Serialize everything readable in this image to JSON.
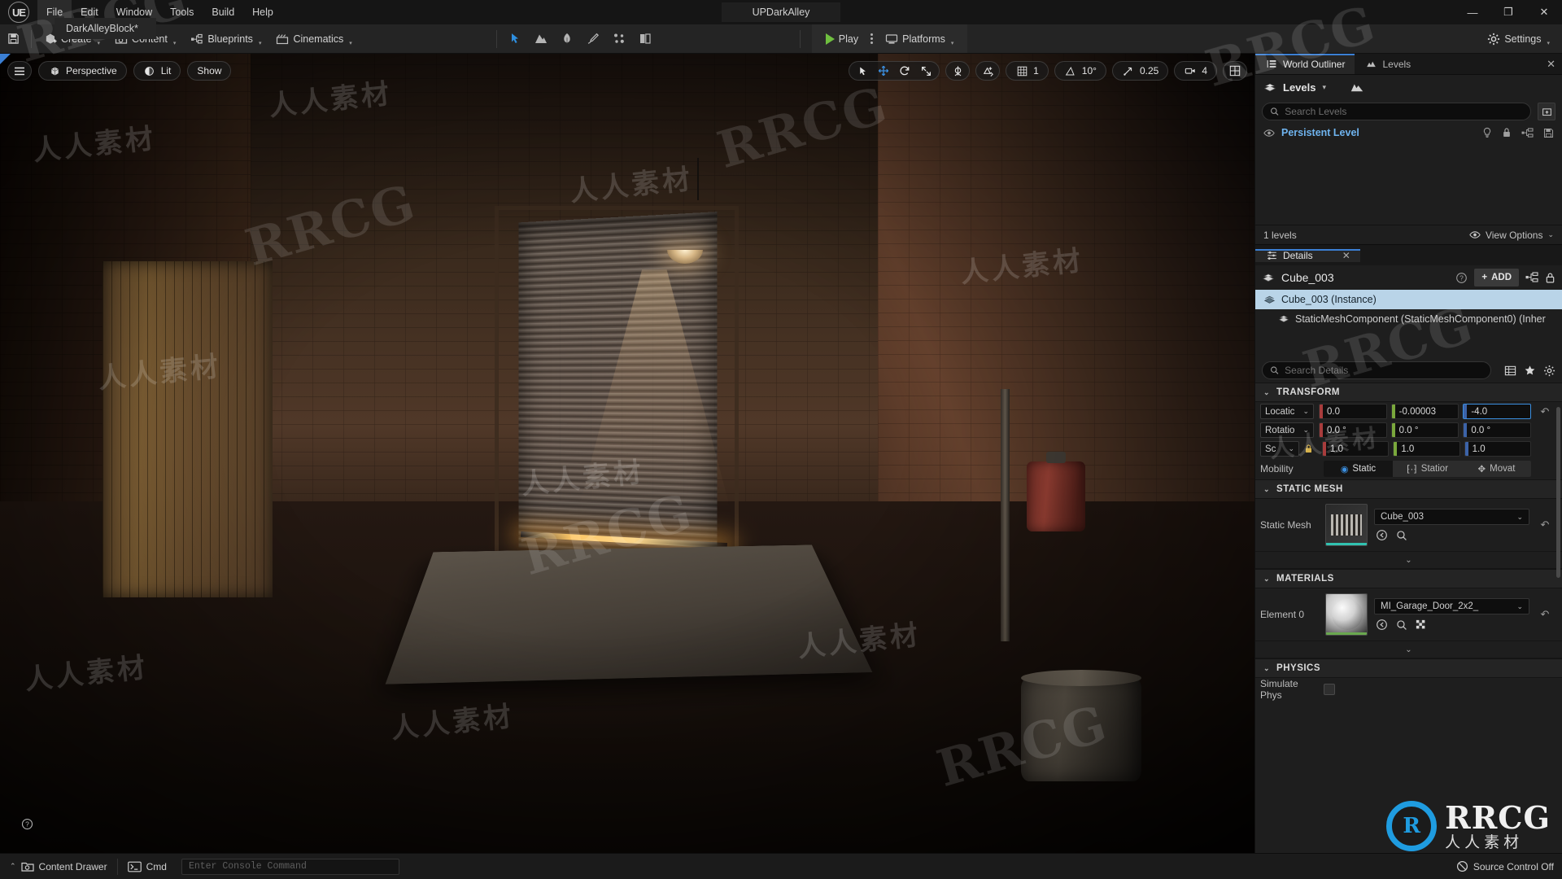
{
  "window": {
    "title": "UPDarkAlley",
    "project_tab": "DarkAlleyBlock*",
    "minimize": "—",
    "maximize": "❐",
    "close": "✕",
    "logo_text": "UE"
  },
  "menubar": {
    "items": [
      {
        "label": "File",
        "active": true
      },
      {
        "label": "Edit",
        "active": false
      },
      {
        "label": "Window",
        "active": false
      },
      {
        "label": "Tools",
        "active": false
      },
      {
        "label": "Build",
        "active": false
      },
      {
        "label": "Help",
        "active": false
      }
    ]
  },
  "toolbar": {
    "save_label": "Save",
    "buttons": [
      {
        "label": "Create",
        "icon": "create-icon"
      },
      {
        "label": "Content",
        "icon": "content-icon"
      },
      {
        "label": "Blueprints",
        "icon": "blueprints-icon"
      },
      {
        "label": "Cinematics",
        "icon": "cinematics-icon"
      }
    ],
    "modes": [
      {
        "name": "select-mode-icon"
      },
      {
        "name": "landscape-mode-icon"
      },
      {
        "name": "foliage-mode-icon"
      },
      {
        "name": "mesh-paint-mode-icon"
      },
      {
        "name": "fracture-mode-icon"
      },
      {
        "name": "brush-edit-mode-icon"
      }
    ],
    "play_label": "Play",
    "platforms_label": "Platforms",
    "settings_label": "Settings"
  },
  "viewport": {
    "menu_icon": "hamburger-icon",
    "perspective_label": "Perspective",
    "lit_label": "Lit",
    "show_label": "Show",
    "transform_tools": [
      {
        "name": "select-tool",
        "glyph": "arrow",
        "active": false
      },
      {
        "name": "translate-tool",
        "glyph": "move",
        "active": true
      },
      {
        "name": "rotate-tool",
        "glyph": "rotate",
        "active": false
      },
      {
        "name": "scale-tool",
        "glyph": "scale",
        "active": false
      }
    ],
    "coord_space_icon": "world-coordinate-icon",
    "surface_snap_icon": "surface-snapping-icon",
    "grid_snap_value": "1",
    "angle_snap_value": "10°",
    "scale_snap_value": "0.25",
    "camera_speed_value": "4",
    "layouts_icon": "viewport-layouts-icon",
    "help_icon": "help-circle-icon"
  },
  "right_panel": {
    "tabs": [
      {
        "label": "World Outliner",
        "icon": "world-outliner-icon",
        "active": true
      },
      {
        "label": "Levels",
        "icon": "levels-icon",
        "active": false
      }
    ],
    "close_label": "✕",
    "levels": {
      "title": "Levels",
      "caret": "▾",
      "search_placeholder": "Search Levels",
      "add_level_icon": "add-level-icon",
      "rows": [
        {
          "name": "Persistent Level",
          "eye_icon": "visibility-icon",
          "light_icon": "lightbulb-icon",
          "lock_icon": "lock-icon",
          "blueprint_icon": "level-blueprint-icon",
          "save_icon": "save-icon"
        }
      ],
      "count_label": "1 levels",
      "view_options_label": "View Options",
      "view_options_caret": "⌄"
    },
    "details": {
      "tab_label": "Details",
      "tab_icon": "details-icon",
      "close_label": "✕",
      "object_name": "Cube_003",
      "help_icon": "help-circle-icon",
      "add_label": "ADD",
      "blueprint_icon": "open-blueprint-icon",
      "lock_icon": "lock-details-icon",
      "tree": [
        {
          "label": "Cube_003 (Instance)",
          "selected": true
        },
        {
          "label": "StaticMeshComponent (StaticMeshComponent0) (Inher",
          "selected": false
        }
      ],
      "search_placeholder": "Search Details",
      "toolbar_icons": [
        "column-view-icon",
        "favorites-star-icon",
        "settings-gear-icon"
      ],
      "sections": {
        "transform": {
          "title": "TRANSFORM",
          "rows": [
            {
              "label": "Location",
              "combo": "Locatic",
              "x": "0.0",
              "y": "-0.00003",
              "z": "-4.0",
              "focus_axis": "z",
              "has_lock": false
            },
            {
              "label": "Rotation",
              "combo": "Rotatio",
              "x": "0.0 °",
              "y": "0.0 °",
              "z": "0.0 °",
              "focus_axis": "",
              "has_lock": false
            },
            {
              "label": "Scale",
              "combo": "Sc",
              "x": "1.0",
              "y": "1.0",
              "z": "1.0",
              "focus_axis": "",
              "has_lock": true
            }
          ],
          "mobility_label": "Mobility",
          "mobility_options": [
            {
              "label": "Static",
              "selected": true
            },
            {
              "label": "Statior",
              "selected": false
            },
            {
              "label": "Movat",
              "selected": false
            }
          ]
        },
        "static_mesh": {
          "title": "STATIC MESH",
          "label": "Static Mesh",
          "value": "Cube_003",
          "caret": "⌄",
          "tools": [
            "browse-to-asset-icon",
            "search-asset-icon"
          ],
          "reset_icon": "reset-arrow-icon",
          "expand_icon": "expand-chevron-icon"
        },
        "materials": {
          "title": "MATERIALS",
          "label": "Element 0",
          "value": "MI_Garage_Door_2x2_",
          "caret": "⌄",
          "tools": [
            "browse-to-asset-icon",
            "search-asset-icon",
            "checker-preview-icon"
          ],
          "reset_icon": "reset-arrow-icon",
          "expand_icon": "expand-chevron-icon"
        },
        "physics": {
          "title": "PHYSICS",
          "label": "Simulate Phys",
          "checked": false
        }
      }
    }
  },
  "statusbar": {
    "content_drawer_label": "Content Drawer",
    "content_drawer_caret": "⌃",
    "cmd_label": "Cmd",
    "console_placeholder": "Enter Console Command",
    "source_control_label": "Source Control Off",
    "source_control_icon": "source-control-off-icon"
  },
  "watermarks": {
    "cn_text": "人人素材",
    "rrcg_text": "RRCG",
    "logo_brand": "RRCG",
    "logo_sub": "人人素材",
    "logo_mark": "R"
  }
}
